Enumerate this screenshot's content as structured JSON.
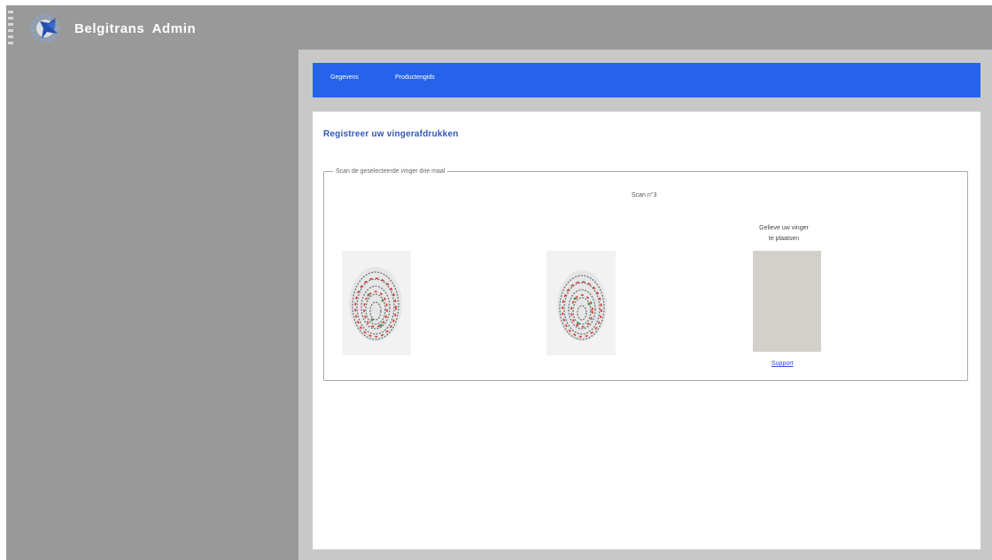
{
  "app": {
    "title": "Belgitrans  Admin"
  },
  "nav": {
    "items": [
      {
        "label": "Gegevens"
      },
      {
        "label": "Productengids"
      }
    ]
  },
  "page": {
    "title": "Registreer uw vingerafdrukken"
  },
  "scan_panel": {
    "legend": "Scan de geselecteerde vinger drie maal",
    "scan_number": "Scan n°3",
    "instruction_line1": "Gelieve uw vinger",
    "instruction_line2": "te plaatsen",
    "support_link": "Support"
  },
  "icons": {
    "menu": "menu-icon",
    "logo": "gear-logo-icon"
  },
  "colors": {
    "accent": "#2563eb",
    "background": "#999999",
    "content_bg": "#c8c8c8",
    "title": "#2f57b5",
    "placeholder": "#d3d0cb"
  }
}
